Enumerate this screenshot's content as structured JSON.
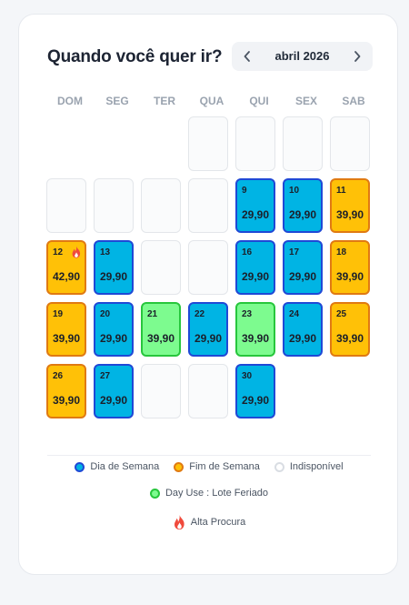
{
  "header": {
    "title": "Quando você quer ir?",
    "month_label": "abril 2026",
    "prev_icon": "chevron-left-icon",
    "next_icon": "chevron-right-icon"
  },
  "weekdays": [
    "DOM",
    "SEG",
    "TER",
    "QUA",
    "QUI",
    "SEX",
    "SAB"
  ],
  "days": [
    {
      "day": "9",
      "price": "29,90",
      "type": "weekday"
    },
    {
      "day": "10",
      "price": "29,90",
      "type": "weekday"
    },
    {
      "day": "11",
      "price": "39,90",
      "type": "weekend"
    },
    {
      "day": "12",
      "price": "42,90",
      "type": "weekend",
      "high_demand": true
    },
    {
      "day": "13",
      "price": "29,90",
      "type": "weekday"
    },
    {
      "day": "16",
      "price": "29,90",
      "type": "weekday"
    },
    {
      "day": "17",
      "price": "29,90",
      "type": "weekday"
    },
    {
      "day": "18",
      "price": "39,90",
      "type": "weekend"
    },
    {
      "day": "19",
      "price": "39,90",
      "type": "weekend"
    },
    {
      "day": "20",
      "price": "29,90",
      "type": "weekday"
    },
    {
      "day": "21",
      "price": "39,90",
      "type": "holiday"
    },
    {
      "day": "22",
      "price": "29,90",
      "type": "weekday"
    },
    {
      "day": "23",
      "price": "39,90",
      "type": "holiday"
    },
    {
      "day": "24",
      "price": "29,90",
      "type": "weekday"
    },
    {
      "day": "25",
      "price": "39,90",
      "type": "weekend"
    },
    {
      "day": "26",
      "price": "39,90",
      "type": "weekend"
    },
    {
      "day": "27",
      "price": "29,90",
      "type": "weekday"
    },
    {
      "day": "30",
      "price": "29,90",
      "type": "weekday"
    }
  ],
  "legend": {
    "weekday": "Dia de Semana",
    "weekend": "Fim de Semana",
    "unavailable": "Indisponível",
    "holiday": "Day Use : Lote Feriado",
    "high_demand": "Alta Procura",
    "high_demand_icon": "fire-icon"
  },
  "colors": {
    "weekday_fill": "#00b4e4",
    "weekday_border": "#1f49d6",
    "weekend_fill": "#ffc107",
    "weekend_border": "#e07a12",
    "holiday_fill": "#7dfb8f",
    "holiday_border": "#27c63c",
    "high_demand": "#f04a3c"
  }
}
